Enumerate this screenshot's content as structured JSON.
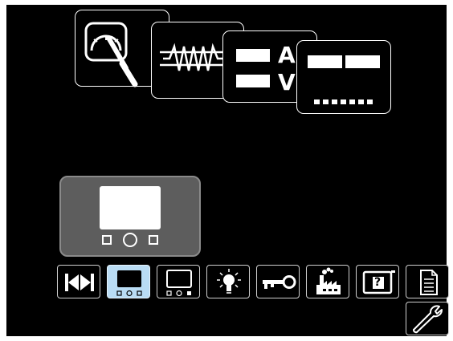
{
  "screen": {
    "top_cards": [
      {
        "id": "gauge",
        "icon": "gauge-icon"
      },
      {
        "id": "waveform",
        "icon": "waveform-icon"
      },
      {
        "id": "amps-volts",
        "icon": "amps-volts-icon",
        "labels": [
          "A",
          "V"
        ]
      },
      {
        "id": "display-layout",
        "icon": "display-layout-icon"
      }
    ],
    "preview": {
      "icon": "display-preview-icon"
    },
    "toolbar": [
      {
        "id": "arrows",
        "icon": "left-right-arrows-icon"
      },
      {
        "id": "display-config-1",
        "icon": "display-config-icon",
        "selected": true
      },
      {
        "id": "display-config-2",
        "icon": "display-config-alt-icon"
      },
      {
        "id": "brightness",
        "icon": "light-bulb-icon"
      },
      {
        "id": "key",
        "icon": "key-icon"
      },
      {
        "id": "factory-reset",
        "icon": "factory-icon"
      },
      {
        "id": "help",
        "icon": "help-icon",
        "label": "?"
      },
      {
        "id": "document",
        "icon": "document-icon"
      }
    ],
    "tools_button": {
      "icon": "wrench-icon"
    },
    "colors": {
      "background": "#000000",
      "selected": "#b9dcf4",
      "preview_panel": "#5d5d5d"
    }
  }
}
